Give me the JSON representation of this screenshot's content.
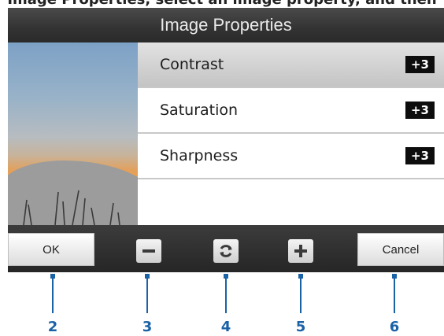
{
  "top_caption": "Image Properties, select an image property, and then",
  "window": {
    "title": "Image Properties"
  },
  "properties": [
    {
      "label": "Contrast",
      "value": "+3",
      "selected": true
    },
    {
      "label": "Saturation",
      "value": "+3",
      "selected": false
    },
    {
      "label": "Sharpness",
      "value": "+3",
      "selected": false
    }
  ],
  "toolbar": {
    "ok_label": "OK",
    "decrease_icon": "minus-icon",
    "reset_icon": "refresh-icon",
    "increase_icon": "plus-icon",
    "cancel_label": "Cancel"
  },
  "callouts": [
    "2",
    "3",
    "4",
    "5",
    "6"
  ],
  "colors": {
    "callout": "#1a62a6",
    "toolbar_bg": "#2b2b2b",
    "badge_bg": "#0d0d0d"
  }
}
